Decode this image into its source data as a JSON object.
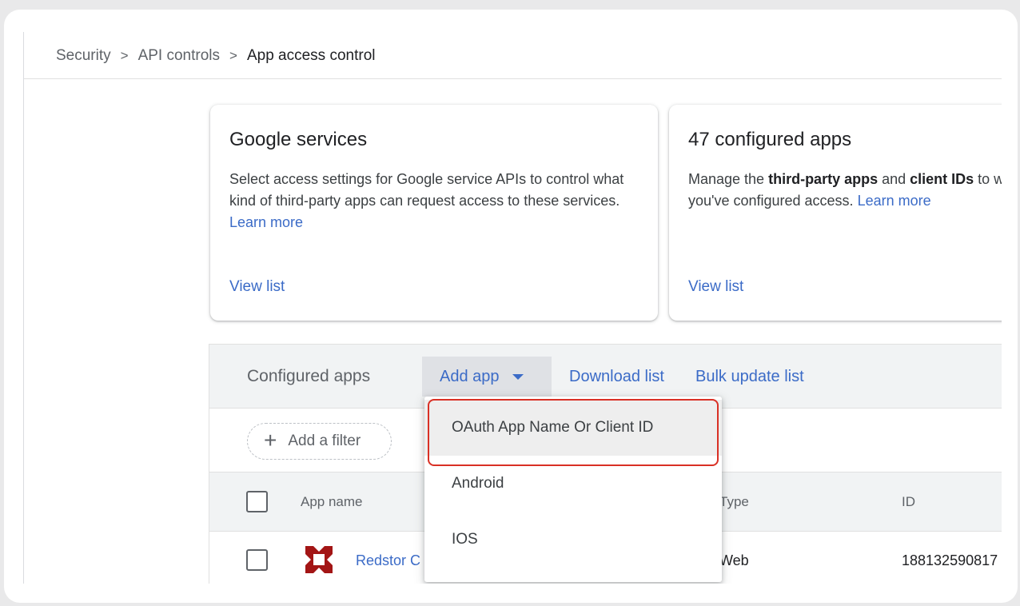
{
  "breadcrumb": {
    "items": [
      "Security",
      "API controls",
      "App access control"
    ],
    "separator": ">"
  },
  "cards": [
    {
      "title": "Google services",
      "description": "Select access settings for Google service APIs to control what kind of third-party apps can request access to these services.",
      "learn_more": "Learn more",
      "view_list": "View list"
    },
    {
      "title": "47 configured apps",
      "description_pre": "Manage the ",
      "description_bold_1": "third-party apps",
      "description_mid": " and ",
      "description_bold_2": "client IDs",
      "description_post": " to which",
      "description_line2": "you've configured access.",
      "learn_more": "Learn more",
      "view_list": "View list"
    }
  ],
  "toolbar": {
    "title": "Configured apps",
    "add_app": "Add app",
    "download_list": "Download list",
    "bulk_update": "Bulk update list"
  },
  "filter": {
    "add_filter": "Add a filter"
  },
  "table": {
    "columns": [
      "App name",
      "Type",
      "ID"
    ],
    "rows": [
      {
        "name": "Redstor C",
        "type": "Web",
        "id": "188132590817"
      }
    ]
  },
  "menu": {
    "items": [
      "OAuth App Name Or Client ID",
      "Android",
      "IOS"
    ],
    "selected_index": 0
  },
  "colors": {
    "link": "#3b6bc7",
    "highlight": "#d93025",
    "logo_red": "#a31515",
    "logo_teal": "#3fb59e"
  }
}
